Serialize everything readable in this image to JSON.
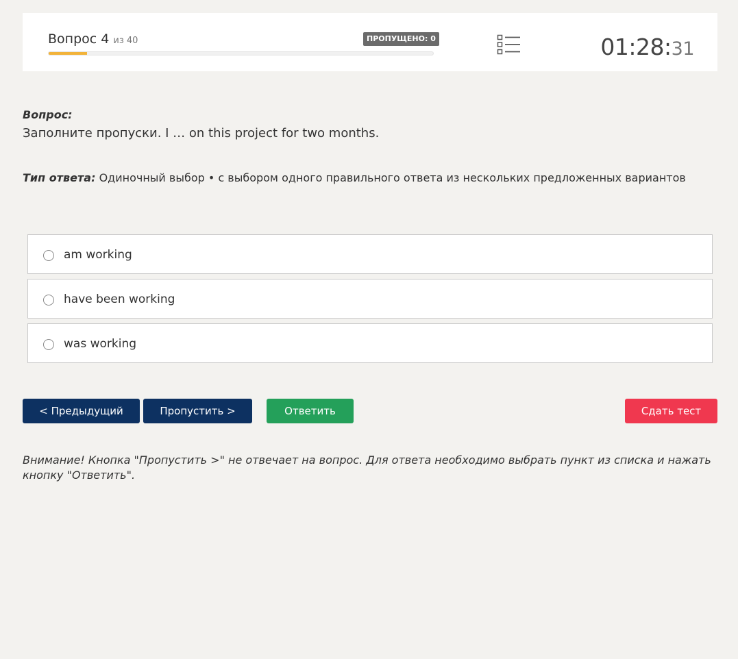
{
  "header": {
    "question_label": "Вопрос 4",
    "question_of": "из 40",
    "skipped_badge": "ПРОПУЩЕНО: 0",
    "progress_fraction": 0.1,
    "timer_main": "01:28:",
    "timer_seconds": "31",
    "list_icon": "list-icon"
  },
  "question": {
    "label": "Вопрос:",
    "text": "Заполните пропуски. I … on this project for two months."
  },
  "answer_type": {
    "label": "Тип ответа:",
    "value": "Одиночный выбор • с выбором одного правильного ответа из нескольких предложенных вариантов"
  },
  "options": [
    {
      "label": "am working"
    },
    {
      "label": "have been working"
    },
    {
      "label": "was working"
    }
  ],
  "buttons": {
    "prev": "< Предыдущий",
    "skip": "Пропустить >",
    "answer": "Ответить",
    "submit": "Сдать тест"
  },
  "notice": "Внимание! Кнопка \"Пропустить >\" не отвечает на вопрос. Для ответа необходимо выбрать пункт из списка и нажать кнопку \"Ответить\".",
  "colors": {
    "background": "#f3f2ef",
    "navy": "#0d3161",
    "green": "#24a05a",
    "red": "#f0384f",
    "progress": "#f2b33a"
  }
}
